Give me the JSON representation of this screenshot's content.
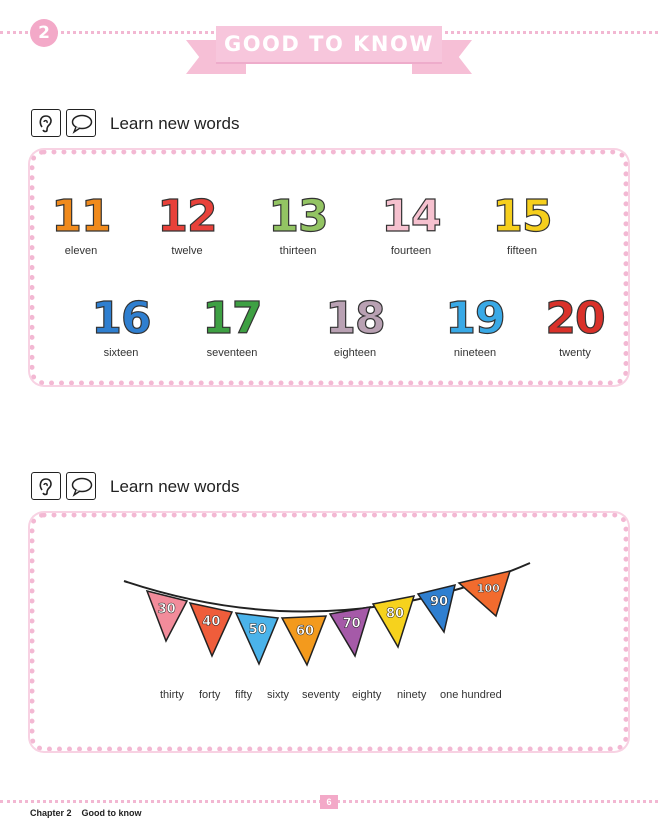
{
  "header": {
    "chapter_number": "2",
    "banner_title": "GOOD TO KNOW"
  },
  "section1": {
    "title": "Learn new words",
    "numbers": [
      {
        "num": "11",
        "word": "eleven",
        "color": "#f08a1c"
      },
      {
        "num": "12",
        "word": "twelve",
        "color": "#e8413a"
      },
      {
        "num": "13",
        "word": "thirteen",
        "color": "#93c463"
      },
      {
        "num": "14",
        "word": "fourteen",
        "color": "#f6c1cf"
      },
      {
        "num": "15",
        "word": "fifteen",
        "color": "#f6cf1d"
      },
      {
        "num": "16",
        "word": "sixteen",
        "color": "#2f7fd0"
      },
      {
        "num": "17",
        "word": "seventeen",
        "color": "#3ea043"
      },
      {
        "num": "18",
        "word": "eighteen",
        "color": "#b9a1b3"
      },
      {
        "num": "19",
        "word": "nineteen",
        "color": "#39a9e6"
      },
      {
        "num": "20",
        "word": "twenty",
        "color": "#d9312a"
      }
    ]
  },
  "section2": {
    "title": "Learn new words",
    "flags": [
      {
        "num": "30",
        "color": "#f28c9b"
      },
      {
        "num": "40",
        "color": "#ef5d3b"
      },
      {
        "num": "50",
        "color": "#4bb3ea"
      },
      {
        "num": "60",
        "color": "#f39a1d"
      },
      {
        "num": "70",
        "color": "#a55aa8"
      },
      {
        "num": "80",
        "color": "#f6d21d"
      },
      {
        "num": "90",
        "color": "#2f7fd0"
      },
      {
        "num": "100",
        "color": "#f26b2e"
      }
    ],
    "words": [
      "thirty",
      "forty",
      "fifty",
      "sixty",
      "seventy",
      "eighty",
      "ninety",
      "one hundred"
    ]
  },
  "footer": {
    "chapter": "Chapter 2",
    "title": "Good to know",
    "page": "6"
  }
}
